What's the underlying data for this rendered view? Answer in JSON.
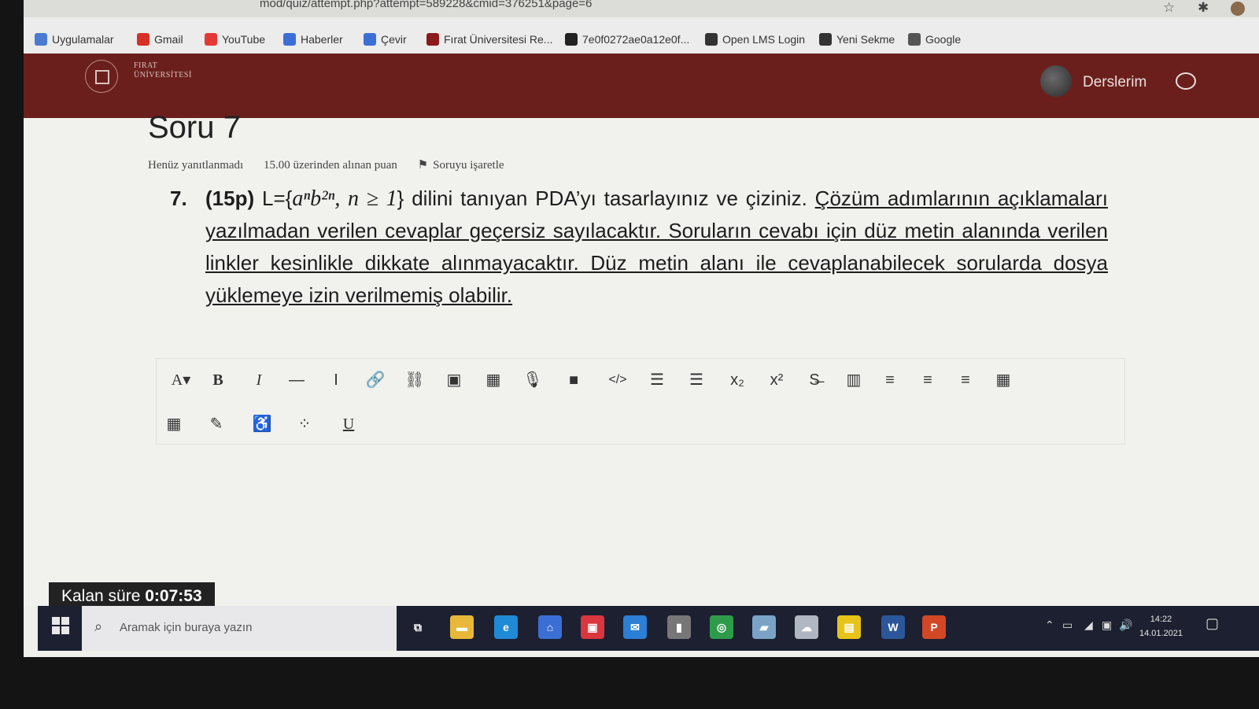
{
  "browser": {
    "url": "mod/quiz/attempt.php?attempt=589228&cmid=376251&page=6",
    "bookmarks": [
      {
        "label": "Uygulamalar",
        "icon": "apps-grid-icon",
        "color": "#4a7bd0"
      },
      {
        "label": "Gmail",
        "icon": "gmail-icon",
        "color": "#d93025"
      },
      {
        "label": "YouTube",
        "icon": "youtube-icon",
        "color": "#e53935"
      },
      {
        "label": "Haberler",
        "icon": "google-news-icon",
        "color": "#3b6fd6"
      },
      {
        "label": "Çevir",
        "icon": "google-translate-icon",
        "color": "#3b6fd6"
      },
      {
        "label": "Fırat Üniversitesi Re...",
        "icon": "firat-university-icon",
        "color": "#8b1a1a"
      },
      {
        "label": "7e0f0272ae0a12e0f...",
        "icon": "github-icon",
        "color": "#222222"
      },
      {
        "label": "Open LMS Login",
        "icon": "globe-icon",
        "color": "#333333"
      },
      {
        "label": "Yeni Sekme",
        "icon": "globe-icon",
        "color": "#333333"
      },
      {
        "label": "Google",
        "icon": "google-icon",
        "color": "#555555"
      }
    ]
  },
  "site": {
    "logo_text_line1": "FIRAT",
    "logo_text_line2": "ÜNİVERSİTESİ",
    "nav_label": "Derslerim",
    "header_color": "#6b1f1c"
  },
  "question": {
    "title": "Soru 7",
    "status": "Henüz yanıtlanmadı",
    "points": "15.00 üzerinden alınan puan",
    "flag_label": "Soruyu işaretle",
    "number": "7.",
    "points_tag": "(15p)",
    "language_prefix": "L={",
    "language_expr": "aⁿb²ⁿ, n ≥ 1",
    "language_suffix": "}",
    "text_plain": " dilini tanıyan PDA’yı tasarlayınız ve çiziniz. ",
    "text_underlined": "Çözüm adımlarının açıklamaları yazılmadan verilen cevaplar geçersiz sayılacaktır. Soruların cevabı için düz metin alanında verilen linkler kesinlikle dikkate alınmayacaktır. Düz metin alanı ile cevaplanabilecek sorularda dosya yüklemeye izin verilmemiş olabilir."
  },
  "editor_toolbar": {
    "row1": [
      {
        "name": "font-style-dropdown",
        "glyph": "A▾"
      },
      {
        "name": "bold-button",
        "glyph": "B"
      },
      {
        "name": "italic-button",
        "glyph": "I"
      },
      {
        "name": "horizontal-rule-button",
        "glyph": "—"
      },
      {
        "name": "text-cursor-button",
        "glyph": "I"
      },
      {
        "name": "link-icon",
        "glyph": "🔗"
      },
      {
        "name": "unlink-icon",
        "glyph": "⛓"
      },
      {
        "name": "image-icon",
        "glyph": "▣"
      },
      {
        "name": "media-icon",
        "glyph": "▦"
      },
      {
        "name": "microphone-icon",
        "glyph": "🎙"
      },
      {
        "name": "video-camera-icon",
        "glyph": "■"
      },
      {
        "name": "html-code-icon",
        "glyph": "</>"
      },
      {
        "name": "bullet-list-icon",
        "glyph": "☰"
      },
      {
        "name": "numbered-list-icon",
        "glyph": "☰"
      },
      {
        "name": "subscript-button",
        "glyph": "x₂"
      },
      {
        "name": "superscript-button",
        "glyph": "x²"
      },
      {
        "name": "strikethrough-icon",
        "glyph": "S̶"
      },
      {
        "name": "columns-icon",
        "glyph": "▥"
      },
      {
        "name": "align-left-icon",
        "glyph": "≡"
      },
      {
        "name": "align-center-icon",
        "glyph": "≡"
      },
      {
        "name": "align-right-icon",
        "glyph": "≡"
      },
      {
        "name": "table-icon",
        "glyph": "▦"
      }
    ],
    "row2": [
      {
        "name": "calculator-icon",
        "glyph": "▦"
      },
      {
        "name": "edit-icon",
        "glyph": "✎"
      },
      {
        "name": "accessibility-icon",
        "glyph": "♿"
      },
      {
        "name": "emoticon-grid-icon",
        "glyph": "⁘"
      },
      {
        "name": "underline-button",
        "glyph": "U"
      }
    ]
  },
  "timer": {
    "label": "Kalan süre",
    "value": "0:07:53"
  },
  "taskbar": {
    "search_placeholder": "Aramak için buraya yazın",
    "apps": [
      {
        "name": "task-view-icon",
        "glyph": "⧉",
        "color": "#1c2030"
      },
      {
        "name": "file-explorer-icon",
        "glyph": "▬",
        "color": "#e8b83a"
      },
      {
        "name": "edge-icon",
        "glyph": "e",
        "color": "#1f8ad6"
      },
      {
        "name": "store-icon",
        "glyph": "⌂",
        "color": "#3b6fd6"
      },
      {
        "name": "gift-icon",
        "glyph": "▣",
        "color": "#d9363e"
      },
      {
        "name": "mail-icon",
        "glyph": "✉",
        "color": "#2b7fd4"
      },
      {
        "name": "recorder-icon",
        "glyph": "▮",
        "color": "#777"
      },
      {
        "name": "chrome-icon",
        "glyph": "◎",
        "color": "#2e9b4a"
      },
      {
        "name": "notebook-icon",
        "glyph": "▰",
        "color": "#7aa3c7"
      },
      {
        "name": "cloud-app-icon",
        "glyph": "☁",
        "color": "#b0b6c2"
      },
      {
        "name": "sticky-notes-icon",
        "glyph": "▤",
        "color": "#e6c419"
      },
      {
        "name": "word-icon",
        "glyph": "W",
        "color": "#2b579a"
      },
      {
        "name": "powerpoint-icon",
        "glyph": "P",
        "color": "#d24726"
      }
    ],
    "clock_time": "14:22",
    "clock_date": "14.01.2021"
  }
}
